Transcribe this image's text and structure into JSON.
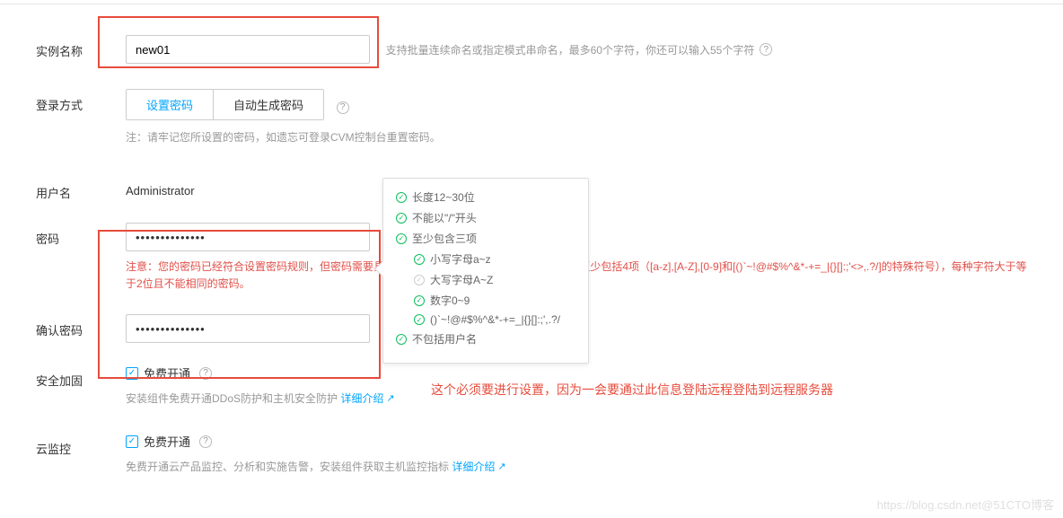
{
  "instance_name": {
    "label": "实例名称",
    "value": "new01",
    "hint": "支持批量连续命名或指定模式串命名，最多60个字符，你还可以输入55个字符"
  },
  "login_method": {
    "label": "登录方式",
    "tabs": [
      "设置密码",
      "自动生成密码"
    ],
    "active_index": 0,
    "note": "注：请牢记您所设置的密码，如遗忘可登录CVM控制台重置密码。"
  },
  "username": {
    "label": "用户名",
    "value": "Administrator"
  },
  "password": {
    "label": "密码",
    "dots": "••••••••••••••",
    "warning": "注意：您的密码已经符合设置密码规则，但密码需要具备一定的强度，建议您设置12位及以上，至少包括4项（[a-z],[A-Z],[0-9]和[()`~!@#$%^&*-+=_|{}[]:;'<>,.?/]的特殊符号），每种字符大于等于2位且不能相同的密码。"
  },
  "confirm_password": {
    "label": "确认密码",
    "dots": "••••••••••••••"
  },
  "password_rules": {
    "items": [
      {
        "text": "长度12~30位",
        "pass": true,
        "indent": false
      },
      {
        "text": "不能以\"/\"开头",
        "pass": true,
        "indent": false
      },
      {
        "text": "至少包含三项",
        "pass": true,
        "indent": false
      },
      {
        "text": "小写字母a~z",
        "pass": true,
        "indent": true
      },
      {
        "text": "大写字母A~Z",
        "pass": false,
        "indent": true
      },
      {
        "text": "数字0~9",
        "pass": true,
        "indent": true
      },
      {
        "text": "()`~!@#$%^&*-+=_|{}[]:;',.?/",
        "pass": true,
        "indent": true
      },
      {
        "text": "不包括用户名",
        "pass": true,
        "indent": false
      }
    ]
  },
  "security": {
    "label": "安全加固",
    "checkbox_label": "免费开通",
    "description": "安装组件免费开通DDoS防护和主机安全防护",
    "link": "详细介绍"
  },
  "cloud_monitor": {
    "label": "云监控",
    "checkbox_label": "免费开通",
    "description": "免费开通云产品监控、分析和实施告警，安装组件获取主机监控指标",
    "link": "详细介绍"
  },
  "annotation": "这个必须要进行设置，因为一会要通过此信息登陆远程登陆到远程服务器",
  "watermark": "https://blog.csdn.net@51CTO博客"
}
